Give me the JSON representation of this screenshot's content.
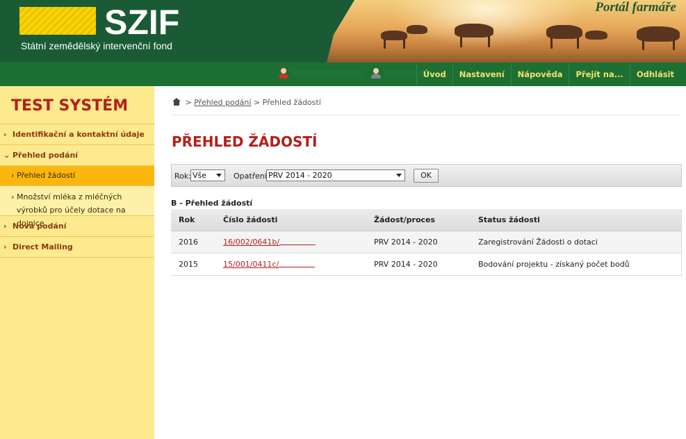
{
  "header": {
    "logo_text": "SZIF",
    "logo_subtitle": "Státní zemědělský intervenční fond",
    "portal_title": "Portál farmáře"
  },
  "topnav": {
    "items": [
      "Úvod",
      "Nastavení",
      "Nápověda",
      "Přejít na...",
      "Odhlásit"
    ]
  },
  "sidebar": {
    "system_title": "TEST SYSTÉM",
    "items": [
      {
        "label": "Identifikační a kontaktní údaje"
      },
      {
        "label": "Přehled podání"
      },
      {
        "label": "Přehled žádostí"
      },
      {
        "label": "Množství mléka z mléčných výrobků pro účely dotace na dojnice"
      },
      {
        "label": "Nová podání"
      },
      {
        "label": "Direct Mailing"
      }
    ]
  },
  "breadcrumb": {
    "separator": ">",
    "link": "Přehled podání",
    "current": "Přehled žádostí"
  },
  "page_title": "PŘEHLED ŽÁDOSTÍ",
  "filter": {
    "rok_label": "Rok:",
    "rok_value": "Vše",
    "opatreni_label": "Opatření:",
    "opatreni_value": "PRV 2014 - 2020",
    "ok_label": "OK"
  },
  "section_label": "B - Přehled žádostí",
  "table": {
    "columns": [
      "Rok",
      "Číslo žádosti",
      "Žádost/proces",
      "Status žádosti"
    ],
    "rows": [
      [
        "2016",
        "16/002/0641b/",
        "PRV 2014 - 2020",
        "Zaregistrování Žádosti o dotaci"
      ],
      [
        "2015",
        "15/001/0411c/",
        "PRV 2014 - 2020",
        "Bodování projektu - získaný počet bodů"
      ]
    ]
  },
  "colors": {
    "header_green": "#1a5b36",
    "nav_green": "#1d6f33",
    "nav_text": "#f7e26a",
    "sidebar_bg": "#fde98e",
    "sidebar_active": "#fbb70f",
    "accent_red": "#b3201a"
  }
}
